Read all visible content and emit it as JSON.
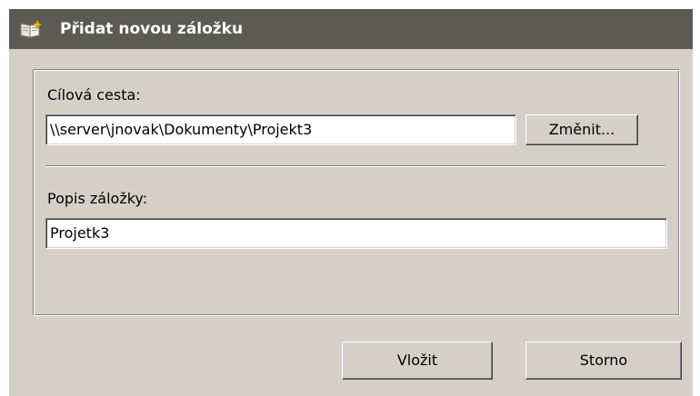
{
  "window": {
    "title": "Přidat novou záložku",
    "icon": "bookmark-add-icon"
  },
  "form": {
    "target_path_label": "Cílová cesta:",
    "target_path_value": "\\\\server\\jnovak\\Dokumenty\\Projekt3",
    "change_button_label": "Změnit...",
    "description_label": "Popis záložky:",
    "description_value": "Projetk3"
  },
  "buttons": {
    "insert_label": "Vložit",
    "cancel_label": "Storno"
  },
  "colors": {
    "titlebar": "#5b5b53",
    "dialog_background": "#d4d0c8"
  }
}
